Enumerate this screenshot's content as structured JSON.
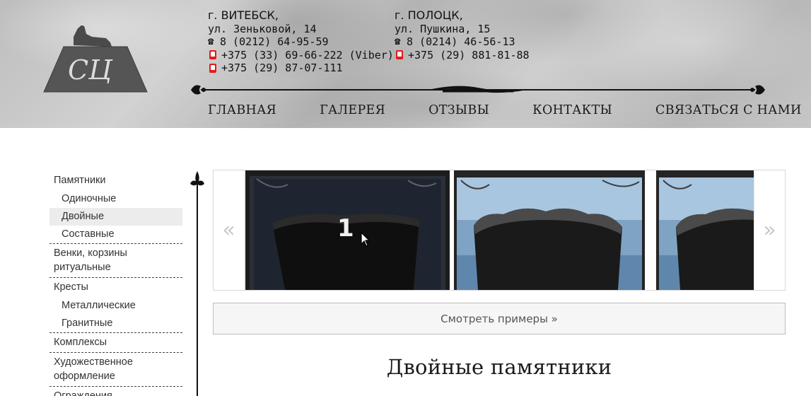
{
  "header": {
    "logo_text": "СЦ",
    "vitebsk": {
      "city": "г. ВИТЕБСК,",
      "address": "ул. Зеньковой, 14",
      "phone": "8 (0212) 64-95-59",
      "mobile1": "+375 (33) 69-66-222 (Viber)",
      "mobile2": "+375 (29) 87-07-111"
    },
    "polotsk": {
      "city": "г. ПОЛОЦК,",
      "address": "ул. Пушкина, 15",
      "phone": "8 (0214) 46-56-13",
      "mobile1": "+375 (29) 881-81-88"
    },
    "phone_icon": "☎",
    "nav": [
      "ГЛАВНАЯ",
      "ГАЛЕРЕЯ",
      "ОТЗЫВЫ",
      "КОНТАКТЫ",
      "СВЯЗАТЬСЯ С НАМИ"
    ]
  },
  "sidebar": {
    "items": [
      {
        "label": "Памятники",
        "level": 0
      },
      {
        "label": "Одиночные",
        "level": 1
      },
      {
        "label": "Двойные",
        "level": 1,
        "active": true
      },
      {
        "label": "Составные",
        "level": 1
      },
      {
        "label": "Венки, корзины ритуальные",
        "level": 0
      },
      {
        "label": "Кресты",
        "level": 0
      },
      {
        "label": "Металлические",
        "level": 1
      },
      {
        "label": "Гранитные",
        "level": 1
      },
      {
        "label": "Комплексы",
        "level": 0
      },
      {
        "label": "Художественное оформление",
        "level": 0
      },
      {
        "label": "Ограждения",
        "level": 0
      }
    ]
  },
  "carousel": {
    "prev_label": "«",
    "next_label": "»",
    "slide_number": "1"
  },
  "examples_button": "Смотреть примеры »",
  "page_title": "Двойные памятники",
  "colors": {
    "header_bg": "#c4c4c4",
    "active_item_bg": "#ececec",
    "mobile_icon": "#e21b1b"
  }
}
